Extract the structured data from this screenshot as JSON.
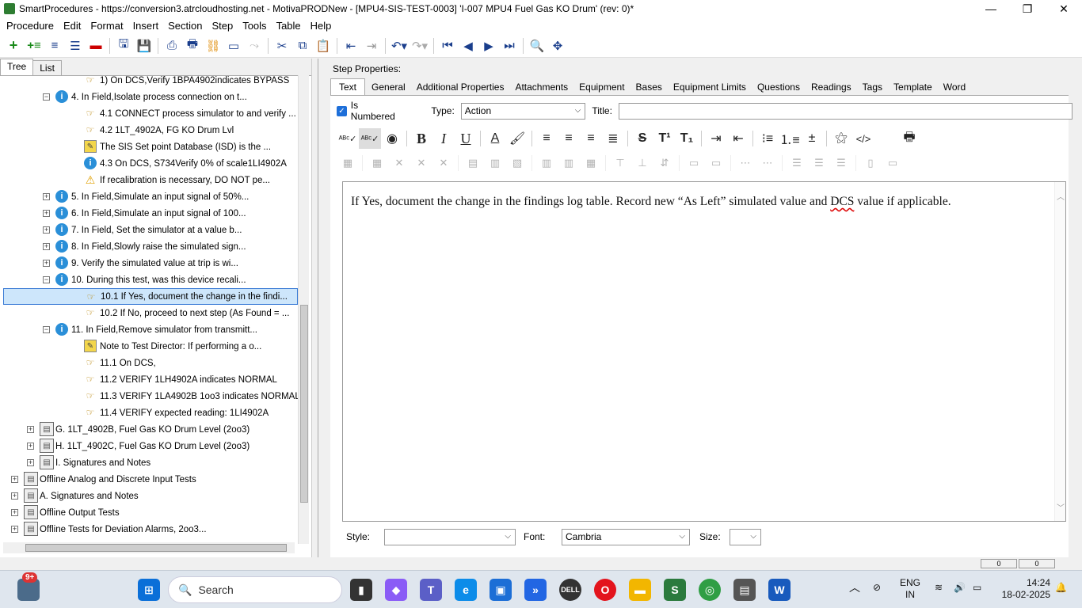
{
  "window": {
    "title": "SmartProcedures - https://conversion3.atrcloudhosting.net - MotivaPRODNew - [MPU4-SIS-TEST-0003] 'I-007 MPU4 Fuel Gas KO Drum' (rev: 0)*",
    "min": "—",
    "max": "❐",
    "close": "✕"
  },
  "menu": [
    "Procedure",
    "Edit",
    "Format",
    "Insert",
    "Section",
    "Step",
    "Tools",
    "Table",
    "Help"
  ],
  "left_tabs": [
    "Tree",
    "List"
  ],
  "tree": [
    {
      "label": "1) On DCS,Verify 1BPA4902indicates BYPASS",
      "icon": "hand",
      "indent": 3,
      "exp": ""
    },
    {
      "label": "4. In Field,Isolate process connection on t...",
      "icon": "info",
      "indent": 2,
      "exp": "−"
    },
    {
      "label": "4.1 CONNECT process simulator to and verify ...",
      "icon": "hand",
      "indent": 3,
      "exp": ""
    },
    {
      "label": "4.2 1LT_4902A, FG KO Drum Lvl",
      "icon": "hand",
      "indent": 3,
      "exp": ""
    },
    {
      "label": "The SIS Set point Database (ISD) is the ...",
      "icon": "note",
      "indent": 3,
      "exp": ""
    },
    {
      "label": "4.3 On DCS, S734Verify 0% of scale1LI4902A",
      "icon": "info",
      "indent": 3,
      "exp": ""
    },
    {
      "label": "If recalibration is necessary, DO NOT pe...",
      "icon": "warn",
      "indent": 3,
      "exp": ""
    },
    {
      "label": "5. In Field,Simulate an input signal of 50%...",
      "icon": "info",
      "indent": 2,
      "exp": "+"
    },
    {
      "label": "6. In Field,Simulate an input signal of 100...",
      "icon": "info",
      "indent": 2,
      "exp": "+"
    },
    {
      "label": "7. In Field, Set the simulator at a value b...",
      "icon": "info",
      "indent": 2,
      "exp": "+"
    },
    {
      "label": "8. In Field,Slowly raise the simulated sign...",
      "icon": "info",
      "indent": 2,
      "exp": "+"
    },
    {
      "label": "9. Verify the simulated value at trip is wi...",
      "icon": "info",
      "indent": 2,
      "exp": "+"
    },
    {
      "label": "10. During this test, was this device recali...",
      "icon": "info",
      "indent": 2,
      "exp": "−"
    },
    {
      "label": "10.1 If Yes, document the change in the findi...",
      "icon": "hand",
      "indent": 3,
      "exp": "",
      "selected": true
    },
    {
      "label": "10.2 If No, proceed to next step (As Found = ...",
      "icon": "hand",
      "indent": 3,
      "exp": ""
    },
    {
      "label": "11. In Field,Remove simulator from transmitt...",
      "icon": "info",
      "indent": 2,
      "exp": "−"
    },
    {
      "label": "Note to Test Director: If performing a o...",
      "icon": "note",
      "indent": 3,
      "exp": ""
    },
    {
      "label": "11.1 On DCS,",
      "icon": "hand",
      "indent": 3,
      "exp": ""
    },
    {
      "label": "11.2 VERIFY 1LH4902A  indicates NORMAL",
      "icon": "hand",
      "indent": 3,
      "exp": ""
    },
    {
      "label": "11.3 VERIFY 1LA4902B 1oo3  indicates NORMAL",
      "icon": "hand",
      "indent": 3,
      "exp": ""
    },
    {
      "label": "11.4 VERIFY expected reading: 1LI4902A",
      "icon": "hand",
      "indent": 3,
      "exp": ""
    },
    {
      "label": "G. 1LT_4902B, Fuel Gas KO Drum Level (2oo3)",
      "icon": "sect",
      "indent": 1,
      "exp": "+"
    },
    {
      "label": "H. 1LT_4902C, Fuel Gas KO Drum Level (2oo3)",
      "icon": "sect",
      "indent": 1,
      "exp": "+"
    },
    {
      "label": "I. Signatures and Notes",
      "icon": "sect",
      "indent": 1,
      "exp": "+"
    },
    {
      "label": "Offline Analog and Discrete Input Tests",
      "icon": "sect",
      "indent": 0,
      "exp": "+"
    },
    {
      "label": "A. Signatures and Notes",
      "icon": "sect",
      "indent": 0,
      "exp": "+"
    },
    {
      "label": "Offline Output Tests",
      "icon": "sect",
      "indent": 0,
      "exp": "+"
    },
    {
      "label": "Offline Tests for Deviation Alarms, 2oo3...",
      "icon": "sect",
      "indent": 0,
      "exp": "+"
    }
  ],
  "step_properties": {
    "label": "Step Properties:",
    "tabs": [
      "Text",
      "General",
      "Additional Properties",
      "Attachments",
      "Equipment",
      "Bases",
      "Equipment Limits",
      "Questions",
      "Readings",
      "Tags",
      "Template",
      "Word"
    ],
    "is_numbered_label": "Is Numbered",
    "type_label": "Type:",
    "type_value": "Action",
    "title_label": "Title:",
    "title_value": "",
    "text_before": "If Yes, document the change in the findings log table. Record new “As Left” simulated value and ",
    "text_misspelled": "DCS",
    "text_after": " value if applicable.",
    "style_label": "Style:",
    "style_value": "",
    "font_label": "Font:",
    "font_value": "Cambria",
    "size_label": "Size:",
    "size_value": ""
  },
  "taskbar": {
    "search": "Search",
    "badge": "9+",
    "lang1": "ENG",
    "lang2": "IN",
    "time": "14:24",
    "date": "18-02-2025"
  },
  "status": [
    "0",
    "0"
  ]
}
